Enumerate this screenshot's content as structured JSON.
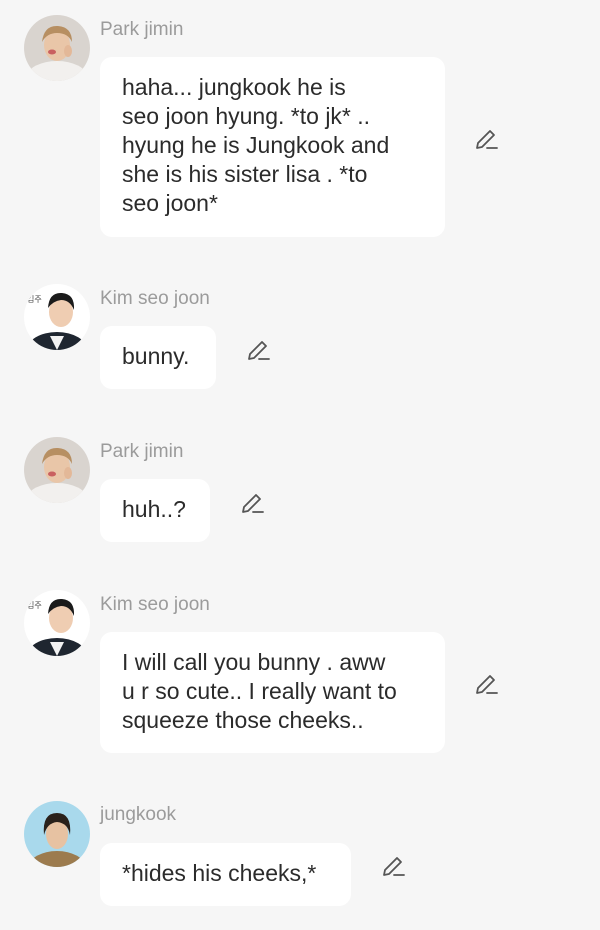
{
  "messages": [
    {
      "sender": "Park jimin",
      "avatar": "park-jimin-avatar",
      "lines": [
        "haha... jungkook he is",
        "seo joon hyung.   *to jk* ..",
        "hyung he is Jungkook and",
        "she is his sister lisa . *to",
        "seo joon*"
      ],
      "edit_icon": "pencil-icon"
    },
    {
      "sender": "Kim seo joon",
      "avatar": "kim-seo-joon-avatar",
      "lines": [
        "bunny."
      ],
      "edit_icon": "pencil-icon"
    },
    {
      "sender": "Park jimin",
      "avatar": "park-jimin-avatar",
      "lines": [
        "huh..?"
      ],
      "edit_icon": "pencil-icon"
    },
    {
      "sender": "Kim seo joon",
      "avatar": "kim-seo-joon-avatar",
      "lines": [
        "I will call you bunny . aww",
        "u r so cute.. I really want to",
        "squeeze those cheeks.."
      ],
      "edit_icon": "pencil-icon"
    },
    {
      "sender": "jungkook",
      "avatar": "jungkook-avatar",
      "lines": [
        "*hides his cheeks,*"
      ],
      "edit_icon": "pencil-icon"
    }
  ],
  "avatar_label": "김주",
  "colors": {
    "background": "#f6f6f6",
    "bubble": "#ffffff",
    "sender_text": "#9b9b9b",
    "message_text": "#2b2b2b"
  }
}
